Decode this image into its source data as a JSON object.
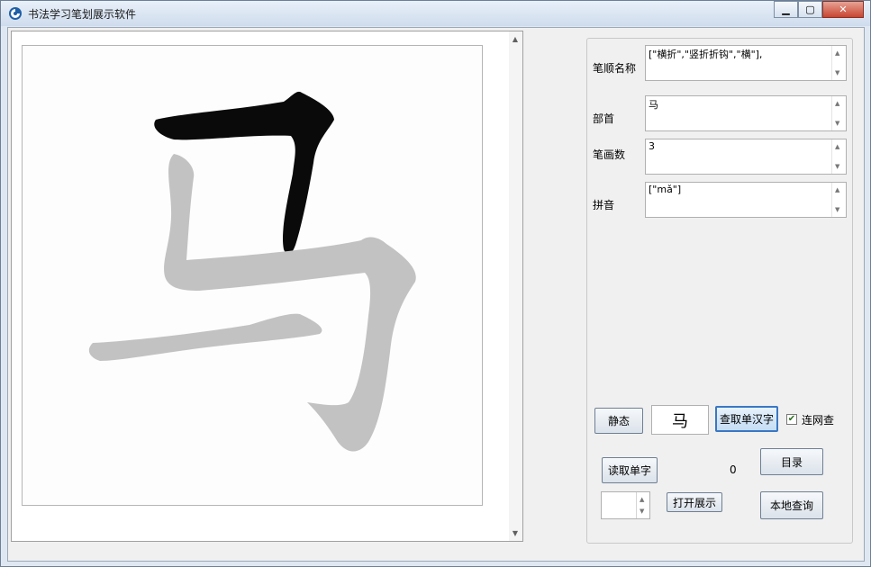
{
  "window": {
    "title": "书法学习笔划展示软件",
    "controls": {
      "minimize": "▭",
      "maximize": "□",
      "close": "✕"
    }
  },
  "canvas": {
    "character": "马",
    "highlight_color": "#0a0a0a",
    "inactive_color": "#c2c2c2"
  },
  "fields": {
    "stroke_order_label": "笔顺名称",
    "stroke_order_value": "[\"横折\",\"竖折折钩\",\"横\"],",
    "radical_label": "部首",
    "radical_value": "马",
    "stroke_count_label": "笔画数",
    "stroke_count_value": "3",
    "pinyin_label": "拼音",
    "pinyin_value": "[\"mǎ\"]"
  },
  "controls": {
    "static_button": "静态",
    "char_input_value": "马",
    "lookup_button": "查取单汉字",
    "online_checkbox_label": "连网查",
    "online_checked": true,
    "read_char_button": "读取单字",
    "counter_value": "0",
    "catalog_button": "目录",
    "open_show_button": "打开展示",
    "local_query_button": "本地查询",
    "spinner_value": ""
  }
}
